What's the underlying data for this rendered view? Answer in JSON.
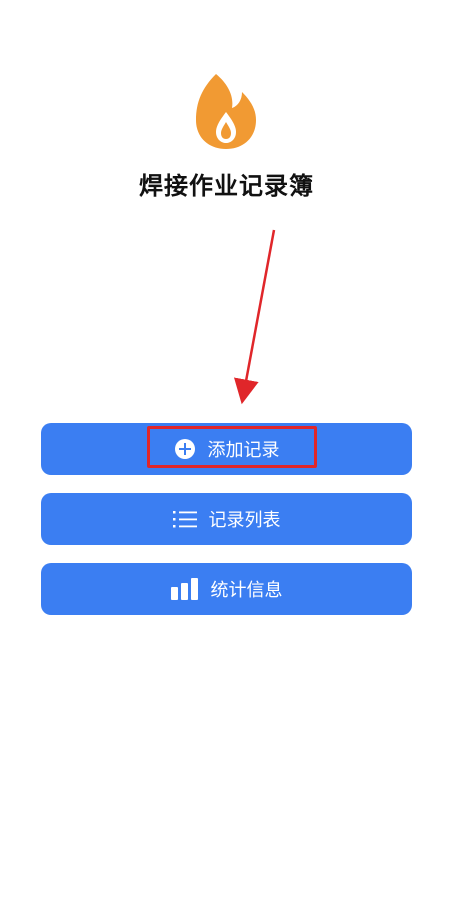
{
  "app": {
    "title": "焊接作业记录簿",
    "logo_icon": "flame-icon",
    "logo_color": "#f19a33"
  },
  "menu": {
    "accent": "#3b7ef2",
    "items": [
      {
        "label": "添加记录",
        "icon": "plus-circle-icon"
      },
      {
        "label": "记录列表",
        "icon": "list-icon"
      },
      {
        "label": "统计信息",
        "icon": "bar-chart-icon"
      }
    ]
  },
  "annotation": {
    "color": "#e0262a"
  }
}
